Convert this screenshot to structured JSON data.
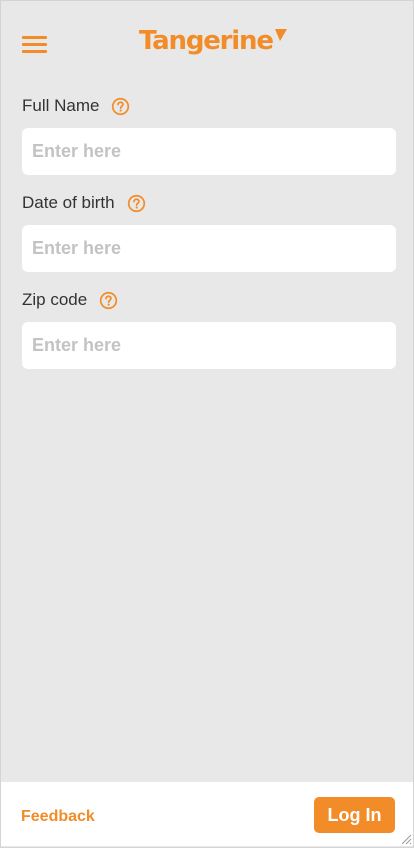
{
  "header": {
    "brand": "Tangerine",
    "menu_icon": "hamburger-menu-icon",
    "brand_mark_icon": "tangerine-arrow-logo-icon"
  },
  "form": {
    "fields": [
      {
        "label": "Full Name",
        "placeholder": "Enter here",
        "value": "",
        "help_icon": "question-circle-icon"
      },
      {
        "label": "Date of birth",
        "placeholder": "Enter here",
        "value": "",
        "help_icon": "question-circle-icon"
      },
      {
        "label": "Zip code",
        "placeholder": "Enter here",
        "value": "",
        "help_icon": "question-circle-icon"
      }
    ]
  },
  "footer": {
    "feedback_label": "Feedback",
    "login_label": "Log In"
  },
  "colors": {
    "accent": "#f28c28",
    "background": "#e8e8e8",
    "input_background": "#ffffff",
    "placeholder": "#c3c3c3",
    "label_text": "#333333"
  }
}
